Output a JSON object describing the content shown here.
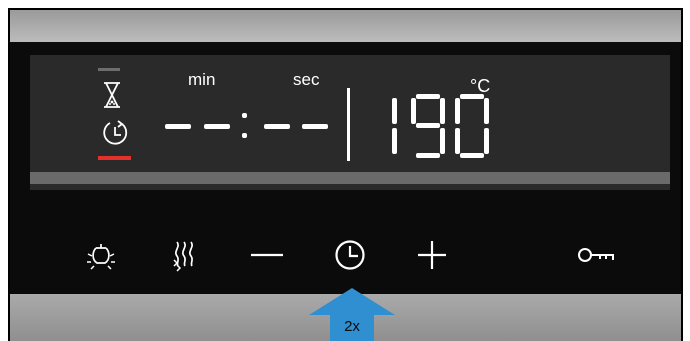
{
  "display": {
    "min_label": "min",
    "sec_label": "sec",
    "time_readout": "- - : - -",
    "temperature": "190",
    "unit": "°C"
  },
  "icons": {
    "timer_program": "hourglass-icon",
    "clock_indicator": "clock-reset-icon",
    "light": "oven-light-icon",
    "heating": "heating-mode-icon",
    "minus": "minus-icon",
    "clock": "clock-icon",
    "plus": "plus-icon",
    "lock": "key-lock-icon"
  },
  "callout": {
    "press_count": "2x"
  },
  "colors": {
    "active_indicator": "#e5312b",
    "callout_arrow": "#2f8fd1"
  }
}
